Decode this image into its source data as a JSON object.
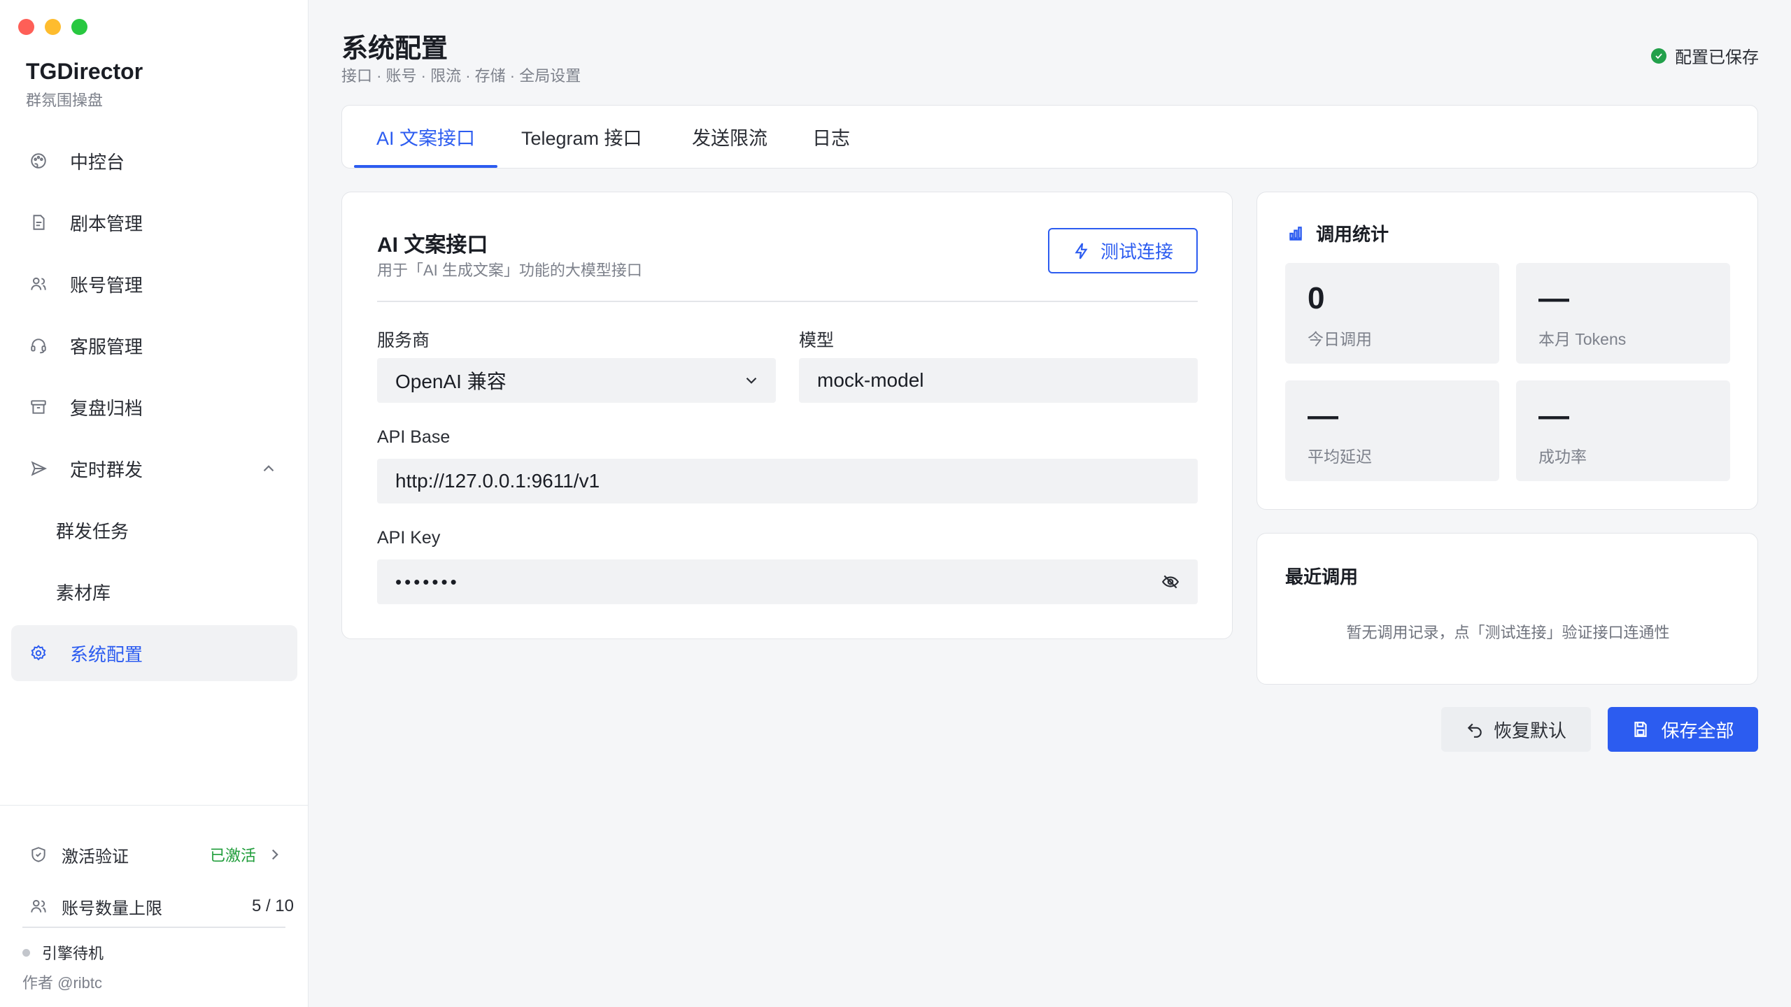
{
  "brand": {
    "title": "TGDirector",
    "subtitle": "群氛围操盘"
  },
  "nav": {
    "items": [
      {
        "label": "中控台",
        "icon": "palette-icon"
      },
      {
        "label": "剧本管理",
        "icon": "document-icon"
      },
      {
        "label": "账号管理",
        "icon": "users-icon"
      },
      {
        "label": "客服管理",
        "icon": "headset-icon"
      },
      {
        "label": "复盘归档",
        "icon": "archive-icon"
      },
      {
        "label": "定时群发",
        "icon": "send-icon",
        "expanded": true
      },
      {
        "label": "群发任务"
      },
      {
        "label": "素材库"
      },
      {
        "label": "系统配置",
        "icon": "gear-icon",
        "active": true
      }
    ]
  },
  "footer": {
    "activation_label": "激活验证",
    "activation_status": "已激活",
    "account_limit_label": "账号数量上限",
    "account_limit_value": "5 / 10",
    "engine_status": "引擎待机",
    "author": "作者 @ribtc"
  },
  "header": {
    "title": "系统配置",
    "subtitle": "接口 · 账号 · 限流 · 存储 · 全局设置",
    "save_status": "配置已保存"
  },
  "tabs": [
    {
      "label": "AI 文案接口",
      "active": true
    },
    {
      "label": "Telegram 接口"
    },
    {
      "label": "发送限流"
    },
    {
      "label": "日志"
    }
  ],
  "form": {
    "title": "AI 文案接口",
    "subtitle": "用于「AI 生成文案」功能的大模型接口",
    "test_button": "测试连接",
    "provider_label": "服务商",
    "provider_value": "OpenAI 兼容",
    "model_label": "模型",
    "model_value": "mock-model",
    "api_base_label": "API Base",
    "api_base_value": "http://127.0.0.1:9611/v1",
    "api_key_label": "API Key",
    "api_key_value": "•••••••"
  },
  "stats": {
    "title": "调用统计",
    "items": [
      {
        "value": "0",
        "label": "今日调用"
      },
      {
        "value": "—",
        "label": "本月 Tokens"
      },
      {
        "value": "—",
        "label": "平均延迟"
      },
      {
        "value": "—",
        "label": "成功率"
      }
    ]
  },
  "recent": {
    "title": "最近调用",
    "empty": "暂无调用记录，点「测试连接」验证接口连通性"
  },
  "actions": {
    "reset": "恢复默认",
    "save": "保存全部"
  },
  "colors": {
    "accent": "#2c5cf0",
    "success": "#22a04b",
    "activated": "#1f9d3a"
  }
}
